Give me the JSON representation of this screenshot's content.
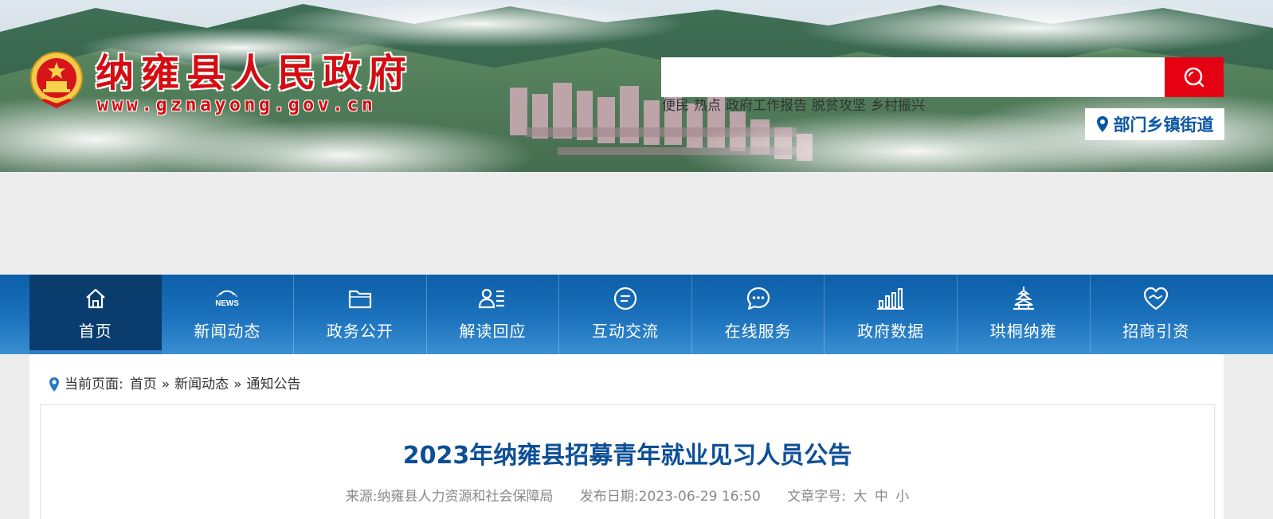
{
  "header": {
    "site_title": "纳雍县人民政府",
    "site_url": "www.gznayong.gov.cn",
    "search_placeholder": "",
    "hot_words": [
      "便民",
      "热点",
      "政府工作报告",
      "脱贫攻坚",
      "乡村振兴"
    ],
    "dept_link": "部门乡镇街道",
    "accent_color": "#e50012"
  },
  "nav": {
    "active_index": 0,
    "items": [
      {
        "label": "首页",
        "icon": "home-icon"
      },
      {
        "label": "新闻动态",
        "icon": "news-icon"
      },
      {
        "label": "政务公开",
        "icon": "folder-icon"
      },
      {
        "label": "解读回应",
        "icon": "person-list-icon"
      },
      {
        "label": "互动交流",
        "icon": "chat-lines-icon"
      },
      {
        "label": "在线服务",
        "icon": "chat-dots-icon"
      },
      {
        "label": "政府数据",
        "icon": "bar-chart-icon"
      },
      {
        "label": "珙桐纳雍",
        "icon": "tower-icon"
      },
      {
        "label": "招商引资",
        "icon": "handshake-heart-icon"
      }
    ]
  },
  "breadcrumb": {
    "prefix": "当前页面:",
    "items": [
      "首页",
      "新闻动态",
      "通知公告"
    ],
    "separator": "»"
  },
  "article": {
    "title": "2023年纳雍县招募青年就业见习人员公告",
    "source_label": "来源:",
    "source": "纳雍县人力资源和社会保障局",
    "date_label": "发布日期:",
    "date": "2023-06-29 16:50",
    "fontsize_label": "文章字号:",
    "fontsize_options": [
      "大",
      "中",
      "小"
    ]
  }
}
